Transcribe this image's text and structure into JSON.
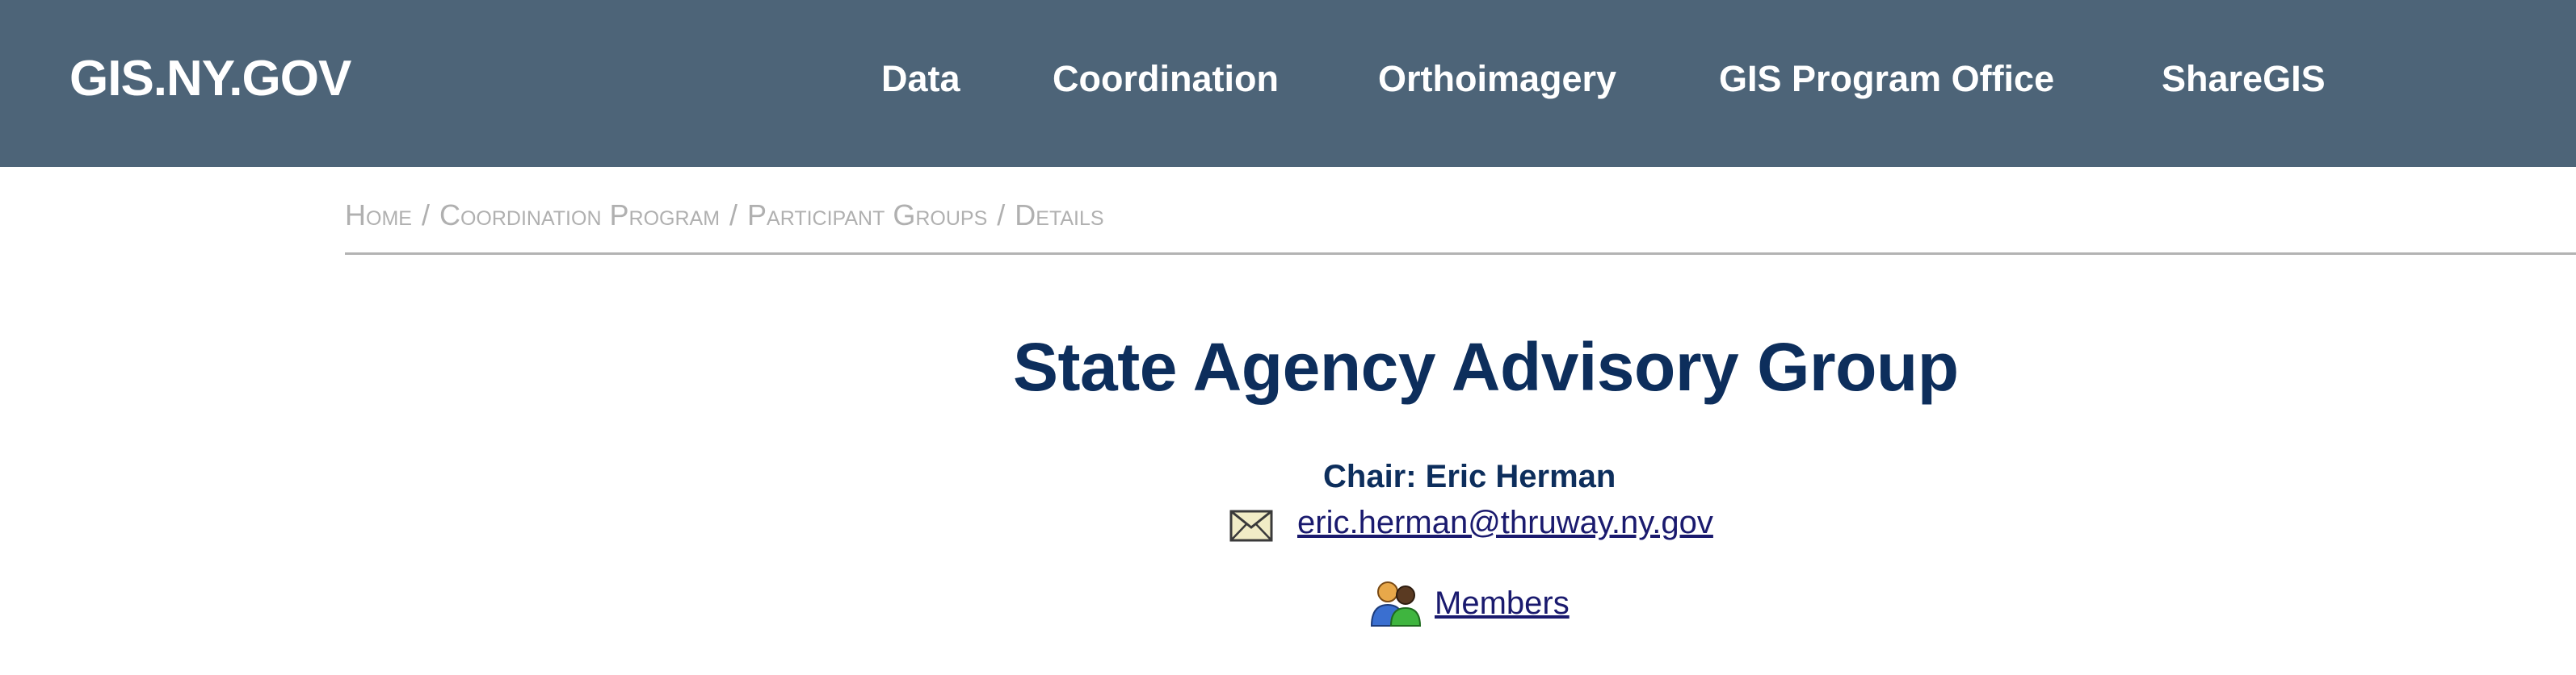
{
  "header": {
    "logo": "GIS.NY.GOV",
    "nav": [
      "Data",
      "Coordination",
      "Orthoimagery",
      "GIS Program Office",
      "ShareGIS"
    ],
    "background_color": "#4d6478"
  },
  "breadcrumb": {
    "items": [
      "Home",
      "Coordination Program",
      "Participant Groups",
      "Details"
    ],
    "separator": "/"
  },
  "main": {
    "title": "State Agency Advisory Group",
    "chair": "Chair: Eric Herman",
    "email": "eric.herman@thruway.ny.gov",
    "email_icon": "envelope-icon",
    "members_label": "Members",
    "members_icon": "people-icon",
    "title_color": "#0d2e5c"
  }
}
